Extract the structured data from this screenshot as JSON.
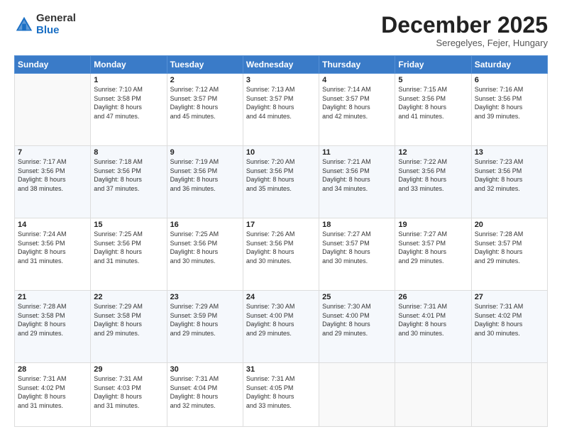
{
  "logo": {
    "general": "General",
    "blue": "Blue"
  },
  "header": {
    "month": "December 2025",
    "location": "Seregelyes, Fejer, Hungary"
  },
  "weekdays": [
    "Sunday",
    "Monday",
    "Tuesday",
    "Wednesday",
    "Thursday",
    "Friday",
    "Saturday"
  ],
  "weeks": [
    [
      {
        "day": "",
        "info": ""
      },
      {
        "day": "1",
        "info": "Sunrise: 7:10 AM\nSunset: 3:58 PM\nDaylight: 8 hours\nand 47 minutes."
      },
      {
        "day": "2",
        "info": "Sunrise: 7:12 AM\nSunset: 3:57 PM\nDaylight: 8 hours\nand 45 minutes."
      },
      {
        "day": "3",
        "info": "Sunrise: 7:13 AM\nSunset: 3:57 PM\nDaylight: 8 hours\nand 44 minutes."
      },
      {
        "day": "4",
        "info": "Sunrise: 7:14 AM\nSunset: 3:57 PM\nDaylight: 8 hours\nand 42 minutes."
      },
      {
        "day": "5",
        "info": "Sunrise: 7:15 AM\nSunset: 3:56 PM\nDaylight: 8 hours\nand 41 minutes."
      },
      {
        "day": "6",
        "info": "Sunrise: 7:16 AM\nSunset: 3:56 PM\nDaylight: 8 hours\nand 39 minutes."
      }
    ],
    [
      {
        "day": "7",
        "info": "Sunrise: 7:17 AM\nSunset: 3:56 PM\nDaylight: 8 hours\nand 38 minutes."
      },
      {
        "day": "8",
        "info": "Sunrise: 7:18 AM\nSunset: 3:56 PM\nDaylight: 8 hours\nand 37 minutes."
      },
      {
        "day": "9",
        "info": "Sunrise: 7:19 AM\nSunset: 3:56 PM\nDaylight: 8 hours\nand 36 minutes."
      },
      {
        "day": "10",
        "info": "Sunrise: 7:20 AM\nSunset: 3:56 PM\nDaylight: 8 hours\nand 35 minutes."
      },
      {
        "day": "11",
        "info": "Sunrise: 7:21 AM\nSunset: 3:56 PM\nDaylight: 8 hours\nand 34 minutes."
      },
      {
        "day": "12",
        "info": "Sunrise: 7:22 AM\nSunset: 3:56 PM\nDaylight: 8 hours\nand 33 minutes."
      },
      {
        "day": "13",
        "info": "Sunrise: 7:23 AM\nSunset: 3:56 PM\nDaylight: 8 hours\nand 32 minutes."
      }
    ],
    [
      {
        "day": "14",
        "info": "Sunrise: 7:24 AM\nSunset: 3:56 PM\nDaylight: 8 hours\nand 31 minutes."
      },
      {
        "day": "15",
        "info": "Sunrise: 7:25 AM\nSunset: 3:56 PM\nDaylight: 8 hours\nand 31 minutes."
      },
      {
        "day": "16",
        "info": "Sunrise: 7:25 AM\nSunset: 3:56 PM\nDaylight: 8 hours\nand 30 minutes."
      },
      {
        "day": "17",
        "info": "Sunrise: 7:26 AM\nSunset: 3:56 PM\nDaylight: 8 hours\nand 30 minutes."
      },
      {
        "day": "18",
        "info": "Sunrise: 7:27 AM\nSunset: 3:57 PM\nDaylight: 8 hours\nand 30 minutes."
      },
      {
        "day": "19",
        "info": "Sunrise: 7:27 AM\nSunset: 3:57 PM\nDaylight: 8 hours\nand 29 minutes."
      },
      {
        "day": "20",
        "info": "Sunrise: 7:28 AM\nSunset: 3:57 PM\nDaylight: 8 hours\nand 29 minutes."
      }
    ],
    [
      {
        "day": "21",
        "info": "Sunrise: 7:28 AM\nSunset: 3:58 PM\nDaylight: 8 hours\nand 29 minutes."
      },
      {
        "day": "22",
        "info": "Sunrise: 7:29 AM\nSunset: 3:58 PM\nDaylight: 8 hours\nand 29 minutes."
      },
      {
        "day": "23",
        "info": "Sunrise: 7:29 AM\nSunset: 3:59 PM\nDaylight: 8 hours\nand 29 minutes."
      },
      {
        "day": "24",
        "info": "Sunrise: 7:30 AM\nSunset: 4:00 PM\nDaylight: 8 hours\nand 29 minutes."
      },
      {
        "day": "25",
        "info": "Sunrise: 7:30 AM\nSunset: 4:00 PM\nDaylight: 8 hours\nand 29 minutes."
      },
      {
        "day": "26",
        "info": "Sunrise: 7:31 AM\nSunset: 4:01 PM\nDaylight: 8 hours\nand 30 minutes."
      },
      {
        "day": "27",
        "info": "Sunrise: 7:31 AM\nSunset: 4:02 PM\nDaylight: 8 hours\nand 30 minutes."
      }
    ],
    [
      {
        "day": "28",
        "info": "Sunrise: 7:31 AM\nSunset: 4:02 PM\nDaylight: 8 hours\nand 31 minutes."
      },
      {
        "day": "29",
        "info": "Sunrise: 7:31 AM\nSunset: 4:03 PM\nDaylight: 8 hours\nand 31 minutes."
      },
      {
        "day": "30",
        "info": "Sunrise: 7:31 AM\nSunset: 4:04 PM\nDaylight: 8 hours\nand 32 minutes."
      },
      {
        "day": "31",
        "info": "Sunrise: 7:31 AM\nSunset: 4:05 PM\nDaylight: 8 hours\nand 33 minutes."
      },
      {
        "day": "",
        "info": ""
      },
      {
        "day": "",
        "info": ""
      },
      {
        "day": "",
        "info": ""
      }
    ]
  ]
}
